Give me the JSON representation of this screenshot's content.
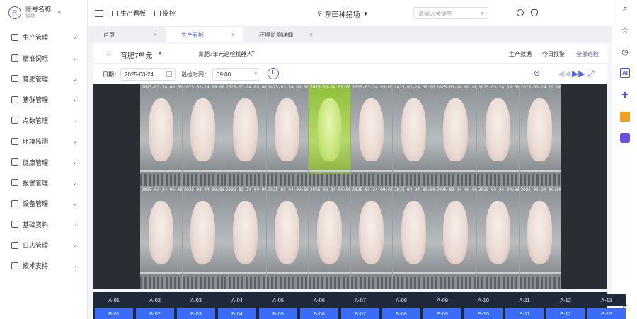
{
  "user": {
    "avatar_letter": "R",
    "name": "账号名称",
    "sub": "管理"
  },
  "sidebar": {
    "items": [
      {
        "label": "生产管理",
        "icon": "production-icon"
      },
      {
        "label": "精准饲喂",
        "icon": "feeding-icon"
      },
      {
        "label": "育肥管理",
        "icon": "fattening-icon"
      },
      {
        "label": "猪群管理",
        "icon": "herd-icon"
      },
      {
        "label": "点数管理",
        "icon": "counting-icon"
      },
      {
        "label": "环境监测",
        "icon": "environment-icon"
      },
      {
        "label": "健康管理",
        "icon": "health-icon"
      },
      {
        "label": "报警管理",
        "icon": "alarm-icon"
      },
      {
        "label": "设备管理",
        "icon": "device-icon"
      },
      {
        "label": "基础资料",
        "icon": "basic-data-icon"
      },
      {
        "label": "日志管理",
        "icon": "log-icon"
      },
      {
        "label": "技术支持",
        "icon": "support-icon"
      }
    ]
  },
  "topbar": {
    "link1": "生产看板",
    "link2": "监控",
    "farm": "东田种猪场",
    "search_placeholder": "请输入关键字"
  },
  "tabs": [
    {
      "label": "首页",
      "active": false
    },
    {
      "label": "生产看板",
      "active": true
    },
    {
      "label": "环境监测详细",
      "active": false
    }
  ],
  "toolbar": {
    "unit": "育肥7单元",
    "robot": "育肥7单元巡检机器人",
    "links": [
      {
        "label": "生产数据",
        "active": false
      },
      {
        "label": "今日报警",
        "active": false
      },
      {
        "label": "全部巡检",
        "active": true
      }
    ]
  },
  "filters": {
    "date_label": "日期：",
    "date_value": "2025-03-24",
    "time_label": "巡检时间：",
    "time_value": "09:00"
  },
  "cameras": {
    "top": [
      {
        "ts": "2025-03-24 09:00",
        "tint": "normal"
      },
      {
        "ts": "2025-03-24 09:00",
        "tint": "normal"
      },
      {
        "ts": "2025-03-24 09:00",
        "tint": "normal"
      },
      {
        "ts": "2025-03-24 09:00",
        "tint": "normal"
      },
      {
        "ts": "2025-03-24 09:00",
        "tint": "green"
      },
      {
        "ts": "2025-03-24 09:00",
        "tint": "normal"
      },
      {
        "ts": "2025-03-24 09:00",
        "tint": "normal"
      },
      {
        "ts": "2025-03-24 09:00",
        "tint": "normal"
      },
      {
        "ts": "2025-03-24 09:00",
        "tint": "normal"
      },
      {
        "ts": "2025-03-24 09:00",
        "tint": "normal"
      }
    ],
    "bottom": [
      {
        "ts": "2025-03-24 09:00",
        "tint": "normal"
      },
      {
        "ts": "2025-03-24 09:00",
        "tint": "normal"
      },
      {
        "ts": "2025-03-24 09:00",
        "tint": "normal"
      },
      {
        "ts": "2025-03-24 09:00",
        "tint": "normal"
      },
      {
        "ts": "2025-03-24 09:00",
        "tint": "normal"
      },
      {
        "ts": "2025-03-24 09:00",
        "tint": "normal"
      },
      {
        "ts": "2025-03-24 09:00",
        "tint": "normal"
      },
      {
        "ts": "2025-03-24 09:00",
        "tint": "normal"
      },
      {
        "ts": "2025-03-24 09:00",
        "tint": "normal"
      },
      {
        "ts": "2025-03-24 09:00",
        "tint": "normal"
      }
    ]
  },
  "pens": {
    "a": [
      "A-01",
      "A-02",
      "A-03",
      "A-04",
      "A-05",
      "A-06",
      "A-07",
      "A-08",
      "A-09",
      "A-10",
      "A-11",
      "A-12",
      "A-13"
    ],
    "b": [
      "B-01",
      "B-02",
      "B-03",
      "B-04",
      "B-05",
      "B-06",
      "B-07",
      "B-08",
      "B-09",
      "B-10",
      "B-11",
      "B-12",
      "B-13"
    ]
  },
  "colors": {
    "accent": "#4f63e8",
    "pen_active": "#3b6cf6",
    "highlight_cell": "#9bc93f"
  }
}
